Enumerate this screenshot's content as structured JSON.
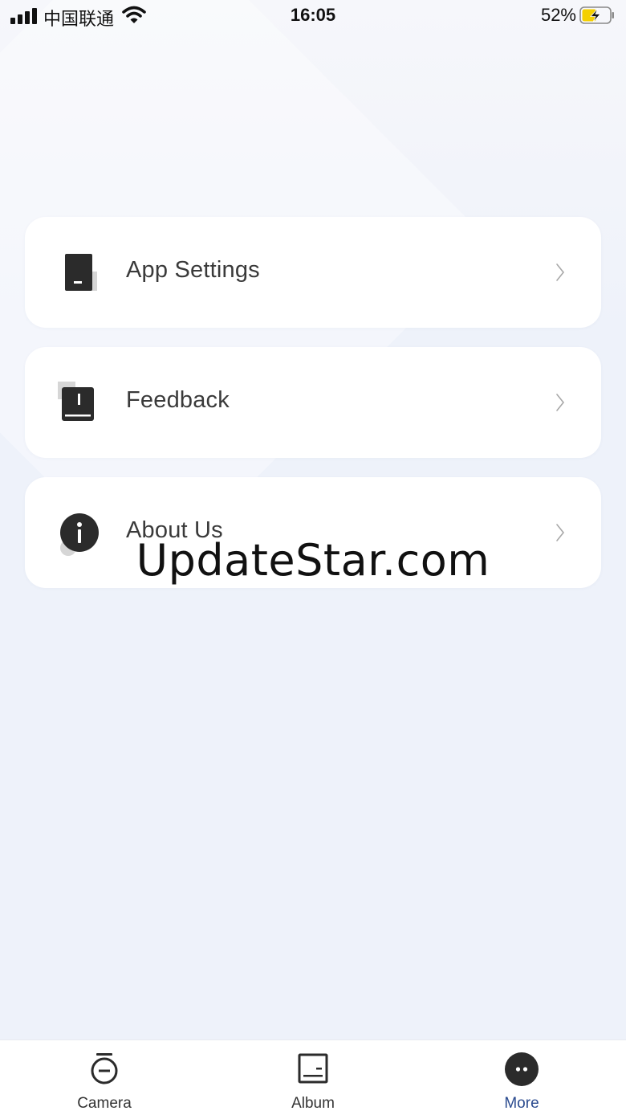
{
  "status_bar": {
    "carrier": "中国联通",
    "time": "16:05",
    "battery_percent": "52%",
    "battery_level": 0.52,
    "charging": true
  },
  "menu": {
    "items": [
      {
        "label": "App Settings",
        "icon": "phone-settings-icon"
      },
      {
        "label": "Feedback",
        "icon": "feedback-book-icon"
      },
      {
        "label": "About Us",
        "icon": "info-icon"
      }
    ]
  },
  "watermark": "UpdateStar.com",
  "tab_bar": {
    "tabs": [
      {
        "label": "Camera",
        "icon": "camera-icon",
        "active": false
      },
      {
        "label": "Album",
        "icon": "album-icon",
        "active": false
      },
      {
        "label": "More",
        "icon": "more-icon",
        "active": true
      }
    ]
  },
  "colors": {
    "background": "#eef2fa",
    "card": "#ffffff",
    "icon_dark": "#2b2b2b",
    "icon_shadow": "#d6d6d6",
    "active_tab": "#2b4b8f",
    "battery_fill": "#f5d000"
  }
}
